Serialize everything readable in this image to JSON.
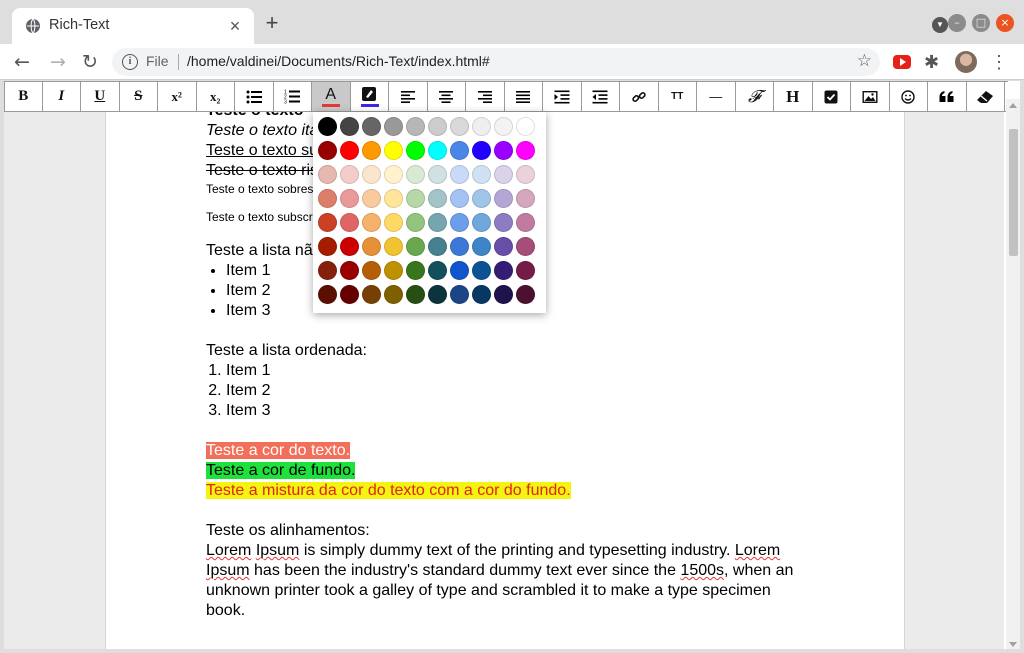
{
  "browser": {
    "tab_title": "Rich-Text",
    "scheme": "File",
    "url": "/home/valdinei/Documents/Rich-Text/index.html#"
  },
  "toolbar": {
    "bold": "B",
    "italic": "I",
    "underline": "U",
    "strike": "S",
    "superscript": "x²",
    "subscript": "x₂",
    "text_color": "A",
    "text_color_swatch": "#e53935",
    "bg_color_swatch": "#3a27e8",
    "font_size": "TT",
    "hr": "—",
    "font": "𝓕",
    "heading": "H"
  },
  "editor": {
    "lines_top": [
      "Teste o texto ",
      "Teste o texto ita",
      "Teste o texto su",
      "Teste o texto ris",
      "Teste o texto sobres",
      "Teste o texto subscri"
    ],
    "unordered_label": "Teste a lista não",
    "unordered_items": [
      "Item 1",
      "Item 2",
      "Item 3"
    ],
    "ordered_label": "Teste a lista ordenada:",
    "ordered_items": [
      "Item 1",
      "Item 2",
      "Item 3"
    ],
    "color_text": "Teste a cor do texto.",
    "bg_text": "Teste a cor de fundo.",
    "mix_text": "Teste a mistura da cor do texto com a cor do fundo.",
    "align_label": "Teste os alinhamentos:",
    "para": {
      "lorem1": "Lorem",
      "ipsum1": "Ipsum",
      "p1": " is simply dummy text of the printing and typesetting industry. ",
      "lorem2": "Lorem",
      "ipsum2": "Ipsum",
      "p2": " has been the industry's standard dummy text ever since the ",
      "year": "1500s",
      "p3": ", when an",
      "line3": "unknown printer took a galley of type and scrambled it to make a type specimen",
      "line4": "book."
    }
  },
  "palette": [
    [
      "#000000",
      "#444444",
      "#666666",
      "#999999",
      "#b7b7b7",
      "#cccccc",
      "#d9d9d9",
      "#efefef",
      "#f3f3f3",
      "#ffffff"
    ],
    [
      "#980000",
      "#ff0000",
      "#ff9900",
      "#ffff00",
      "#00ff00",
      "#00ffff",
      "#4a86e8",
      "#2200ff",
      "#9900ff",
      "#ff00ff"
    ],
    [
      "#e6b8af",
      "#f4cccc",
      "#fce5cd",
      "#fff2cc",
      "#d9ead3",
      "#d0e0e3",
      "#c9daf8",
      "#cfe2f3",
      "#d9d2e9",
      "#ead1dc"
    ],
    [
      "#dd7e6b",
      "#ea9999",
      "#f9cb9c",
      "#ffe599",
      "#b6d7a8",
      "#a2c4c9",
      "#a4c2f4",
      "#9fc5e8",
      "#b4a7d6",
      "#d5a6bd"
    ],
    [
      "#cc4125",
      "#e06666",
      "#f6b26b",
      "#ffd966",
      "#93c47d",
      "#76a5af",
      "#6d9eeb",
      "#6fa8dc",
      "#8e7cc3",
      "#c27ba0"
    ],
    [
      "#a61c00",
      "#cc0000",
      "#e69138",
      "#f1c232",
      "#6aa84f",
      "#45818e",
      "#3c78d8",
      "#3d85c6",
      "#674ea7",
      "#a64d79"
    ],
    [
      "#85200c",
      "#990000",
      "#b45f06",
      "#bf9000",
      "#38761d",
      "#134f5c",
      "#1155cc",
      "#0b5394",
      "#351c75",
      "#741b47"
    ],
    [
      "#5b0f00",
      "#660000",
      "#783f04",
      "#7f6000",
      "#274e13",
      "#0c343d",
      "#1c4587",
      "#073763",
      "#20124d",
      "#4c1130"
    ]
  ]
}
